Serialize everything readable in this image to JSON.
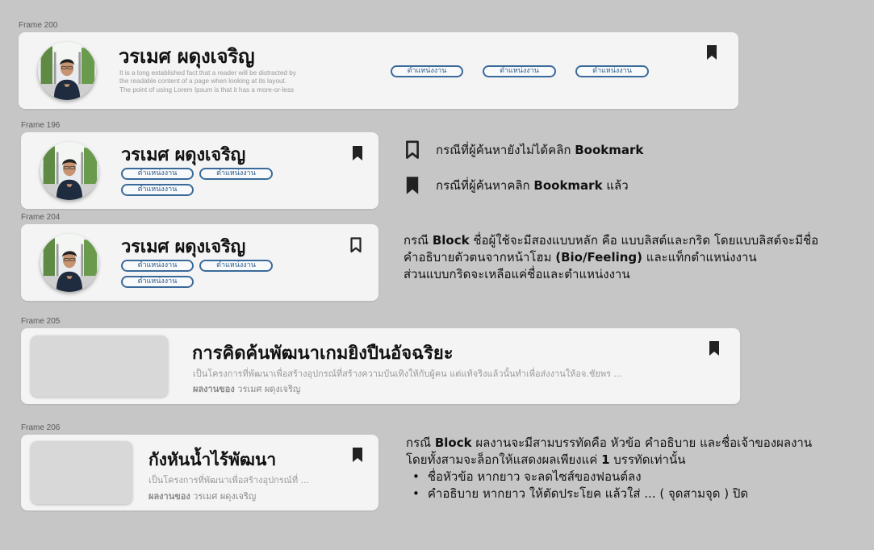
{
  "frames": {
    "f200": "Frame 200",
    "f196": "Frame 196",
    "f204": "Frame 204",
    "f205": "Frame 205",
    "f206": "Frame 206"
  },
  "profile": {
    "name": "วรเมศ ผดุงเจริญ",
    "tag": "ตำแหน่งงาน",
    "bio_line1": "It is a long established fact that a reader will be distracted by",
    "bio_line2": "the readable content of a page when looking at its layout.",
    "bio_line3": "The point of using Lorem Ipsum is that it has a more-or-less"
  },
  "legend": {
    "unbookmarked_pre": "กรณีที่ผู้ค้นหายังไม่ได้คลิก ",
    "unbookmarked_bold": "Bookmark",
    "bookmarked_pre": "กรณีที่ผู้ค้นหาคลิก ",
    "bookmarked_bold": "Bookmark",
    "bookmarked_post": " แล้ว"
  },
  "block_note": {
    "l1_pre": "กรณี ",
    "l1_bold": "Block",
    "l1_post": " ชื่อผู้ใช้จะมีสองแบบหลัก คือ แบบลิสต์และกริด โดยแบบลิสต์จะมีชื่อ",
    "l2_pre": "คำอธิบายตัวตนจากหน้าโฮม ",
    "l2_bold": "(Bio/Feeling)",
    "l2_post": " และแท็กตำแหน่งงาน",
    "l3": "ส่วนแบบกริดจะเหลือแค่ชื่อและตำแหน่งงาน"
  },
  "work1": {
    "title": "การคิดค้นพัฒนาเกมยิงปืนอัจฉริยะ",
    "desc": "เป็นโครงการที่พัฒนาเพื่อสร้างอุปกรณ์ที่สร้างความบันเทิงให้กับผู้คน แต่แท้จริงแล้วนั้นทำเพื่อส่งงานให้อจ.ชัยพร ...",
    "owner_label": "ผลงานของ",
    "owner": " วรเมศ ผดุงเจริญ"
  },
  "work2": {
    "title": "กังหันน้ำไร้พัฒนา",
    "desc": "เป็นโครงการที่พัฒนาเพื่อสร้างอุปกรณ์ที่ ...",
    "owner_label": "ผลงานของ",
    "owner": " วรเมศ ผดุงเจริญ"
  },
  "work_note": {
    "l1_pre": "กรณี ",
    "l1_bold": "Block",
    "l1_post": " ผลงานจะมีสามบรรทัดคือ หัวข้อ คำอธิบาย และชื่อเจ้าของผลงาน",
    "l2_pre": "โดยทั้งสามจะล็อกให้แสดงผลเพียงแค่ ",
    "l2_bold": "1",
    "l2_post": " บรรทัดเท่านั้น",
    "b1": "ชื่อหัวข้อ หากยาว จะลดไซส์ของฟอนต์ลง",
    "b2": "คำอธิบาย หากยาว ให้ตัดประโยค แล้วใส่ ... ( จุดสามจุด ) ปิด"
  },
  "colors": {
    "background": "#c6c6c6",
    "card": "#f4f4f5",
    "tag_border": "#3a6a9a",
    "icon": "#222222"
  },
  "icons": {
    "bookmark_filled": "bookmark-filled-icon",
    "bookmark_outline": "bookmark-outline-icon"
  }
}
